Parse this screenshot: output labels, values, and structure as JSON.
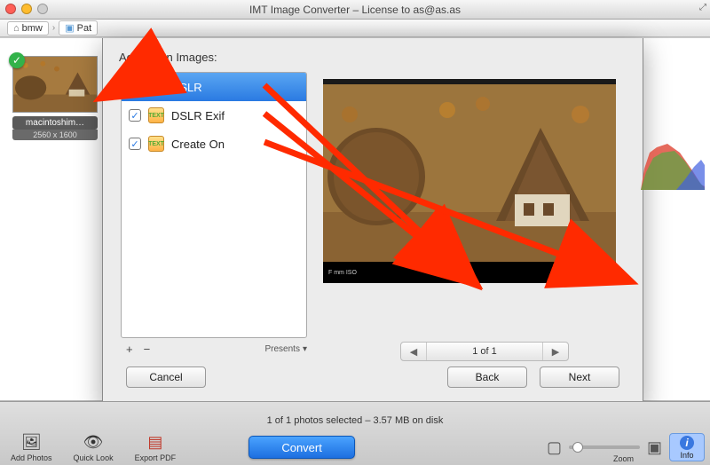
{
  "title": "IMT Image Converter – License to as@as.as",
  "breadcrumbs": {
    "item1": "bmw",
    "item2": "Pat"
  },
  "thumb": {
    "name": "macintoshim…",
    "dimensions": "2560 x 1600"
  },
  "dialog": {
    "header": "Actions on Images:",
    "actions": [
      {
        "label": "DSLR"
      },
      {
        "label": "DSLR Exif"
      },
      {
        "label": "Create On"
      }
    ],
    "add": "+",
    "remove": "−",
    "presents": "Presents",
    "pager": "1 of 1",
    "cancel": "Cancel",
    "back": "Back",
    "next": "Next"
  },
  "status": "1 of 1 photos selected – 3.57 MB on disk",
  "toolbar": {
    "add": "Add Photos",
    "quicklook": "Quick Look",
    "export": "Export PDF",
    "convert": "Convert",
    "zoom": "Zoom",
    "info": "Info"
  }
}
